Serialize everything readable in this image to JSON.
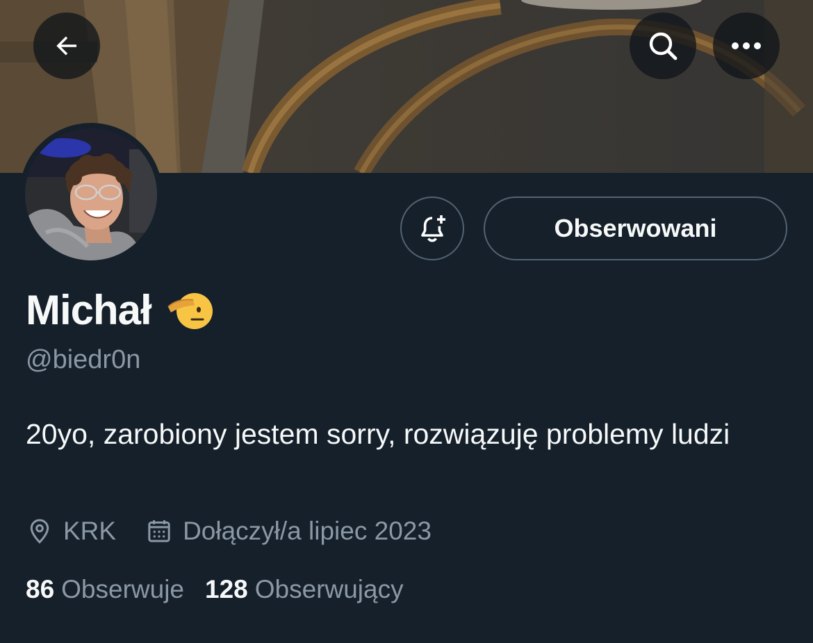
{
  "header": {
    "back_icon": "arrow-left-icon",
    "search_icon": "search-icon",
    "more_icon": "more-dots-icon"
  },
  "profile": {
    "display_name": "Michał",
    "name_emoji": "saluting-face-emoji",
    "handle": "@biedr0n",
    "bio": "20yo, zarobiony jestem sorry, rozwiązuję problemy ludzi",
    "location": "KRK",
    "joined": "Dołączył/a lipiec 2023"
  },
  "actions": {
    "notify_icon": "bell-plus-icon",
    "following_label": "Obserwowani"
  },
  "stats": {
    "following_count": "86",
    "following_label": "Obserwuje",
    "followers_count": "128",
    "followers_label": "Obserwujący"
  },
  "colors": {
    "background": "#15202b",
    "text_primary": "#f7f9f9",
    "text_secondary": "#8b98a5",
    "border": "#536471"
  }
}
